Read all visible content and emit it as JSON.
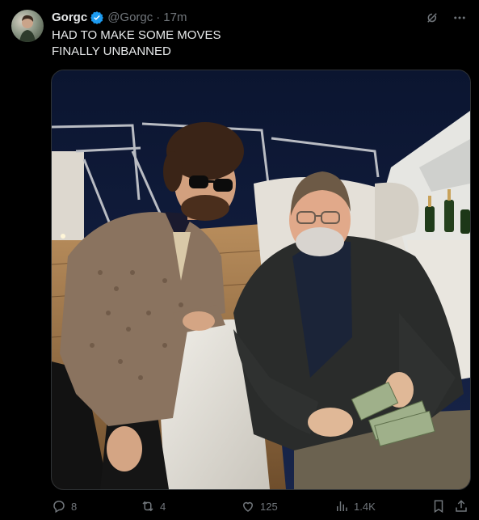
{
  "tweet": {
    "author": {
      "display_name": "Gorgc",
      "handle": "@Gorgc",
      "verified": true,
      "avatar_icon": "avatar-photo"
    },
    "separator": "·",
    "timestamp": "17m",
    "text": "HAD TO MAKE SOME MOVES\nFINALLY UNBANNED",
    "header_icons": [
      "grok-icon",
      "more-icon"
    ],
    "stats": {
      "replies": "8",
      "reposts": "4",
      "likes": "125",
      "views": "1.4K"
    },
    "colors": {
      "background": "#000000",
      "text": "#e7e9ea",
      "muted": "#71767b",
      "verified_blue": "#1d9bf0",
      "border": "#2f3336"
    }
  }
}
